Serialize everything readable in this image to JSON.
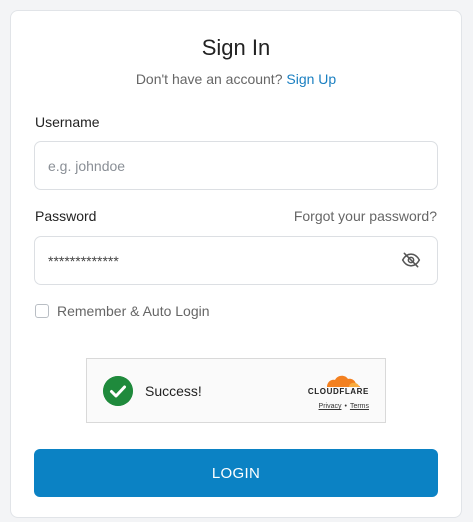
{
  "form": {
    "title": "Sign In",
    "no_account_text": "Don't have an account?",
    "sign_up_link": "Sign Up",
    "username_label": "Username",
    "username_placeholder": "e.g. johndoe",
    "password_label": "Password",
    "forgot_password_link": "Forgot your password?",
    "password_value": "*************",
    "remember_label": "Remember & Auto Login",
    "remember_checked": false,
    "login_button": "LOGIN"
  },
  "captcha": {
    "status_text": "Success!",
    "brand": "CLOUDFLARE",
    "privacy_link": "Privacy",
    "separator": "•",
    "terms_link": "Terms",
    "status_icon": "check-circle-icon",
    "success_color": "#1f8a3c",
    "brand_color": "#f38020"
  },
  "colors": {
    "accent": "#0b82c4",
    "link": "#1a7fc1"
  },
  "icons": {
    "password_toggle": "eye-slash-icon"
  }
}
